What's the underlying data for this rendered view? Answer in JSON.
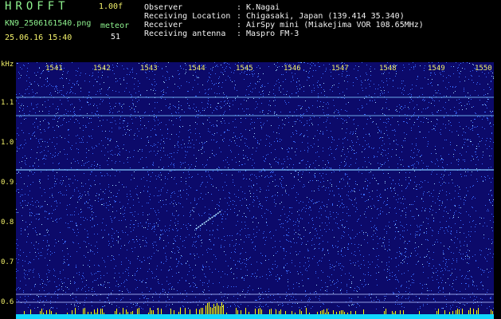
{
  "header": {
    "app_title": "HROFFT",
    "version": "1.00f",
    "filename": "KN9_2506161540.png",
    "datetime": "25.06.16 15:40",
    "meteor_label": "meteor",
    "meteor_count": "51",
    "info": [
      {
        "label": "Observer",
        "value": ": K.Nagai"
      },
      {
        "label": "Receiving Location",
        "value": ": Chigasaki, Japan (139.414 35.340)"
      },
      {
        "label": "Receiver",
        "value": ": AirSpy mini (Miakejima VOR 108.65MHz)"
      },
      {
        "label": "Receiving antenna",
        "value": ": Maspro FM-3"
      }
    ]
  },
  "plot": {
    "y_unit": "kHz",
    "y_ticks": [
      "1.1",
      "1.0",
      "0.9",
      "0.8",
      "0.7",
      "0.6"
    ],
    "x_ticks": [
      "1541",
      "1542",
      "1543",
      "1544",
      "1545",
      "1546",
      "1547",
      "1548",
      "1549",
      "1550"
    ],
    "colors": {
      "background": "#0c0a6a",
      "noise": "#3a6cff",
      "line": "#7ec8ff",
      "meteor": "#b0e8ff",
      "spectrum": "#10d8ff",
      "peaks": "#ffff00"
    }
  }
}
